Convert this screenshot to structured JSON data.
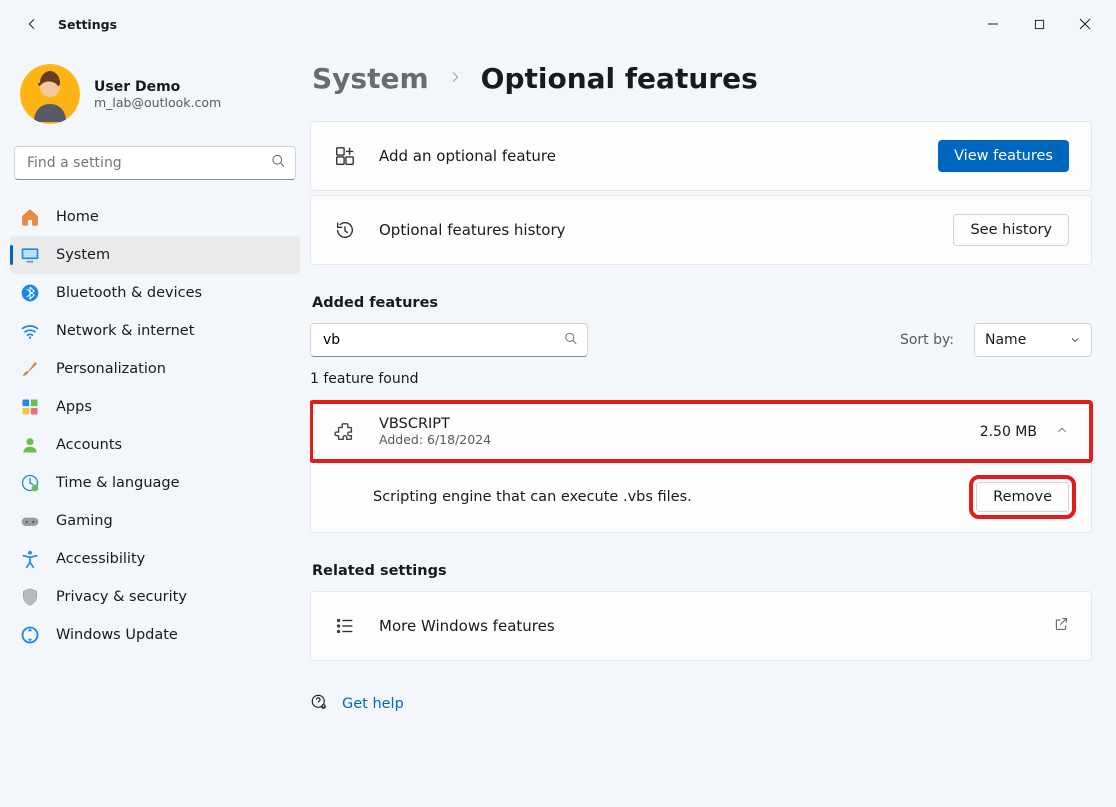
{
  "window": {
    "title": "Settings"
  },
  "user": {
    "name": "User Demo",
    "email": "m_lab@outlook.com"
  },
  "search": {
    "placeholder": "Find a setting"
  },
  "nav": {
    "items": [
      {
        "label": "Home"
      },
      {
        "label": "System"
      },
      {
        "label": "Bluetooth & devices"
      },
      {
        "label": "Network & internet"
      },
      {
        "label": "Personalization"
      },
      {
        "label": "Apps"
      },
      {
        "label": "Accounts"
      },
      {
        "label": "Time & language"
      },
      {
        "label": "Gaming"
      },
      {
        "label": "Accessibility"
      },
      {
        "label": "Privacy & security"
      },
      {
        "label": "Windows Update"
      }
    ]
  },
  "breadcrumb": {
    "parent": "System",
    "current": "Optional features"
  },
  "add_feature": {
    "label": "Add an optional feature",
    "button": "View features"
  },
  "history": {
    "label": "Optional features history",
    "button": "See history"
  },
  "added_section": {
    "title": "Added features"
  },
  "filter": {
    "value": "vb"
  },
  "sort": {
    "label": "Sort by:",
    "value": "Name"
  },
  "result_count": "1 feature found",
  "feature": {
    "name": "VBSCRIPT",
    "added_line": "Added: 6/18/2024",
    "size": "2.50 MB",
    "description": "Scripting engine that can execute .vbs files.",
    "remove_label": "Remove"
  },
  "related_section": {
    "title": "Related settings"
  },
  "more_features": {
    "label": "More Windows features"
  },
  "help": {
    "label": "Get help"
  }
}
